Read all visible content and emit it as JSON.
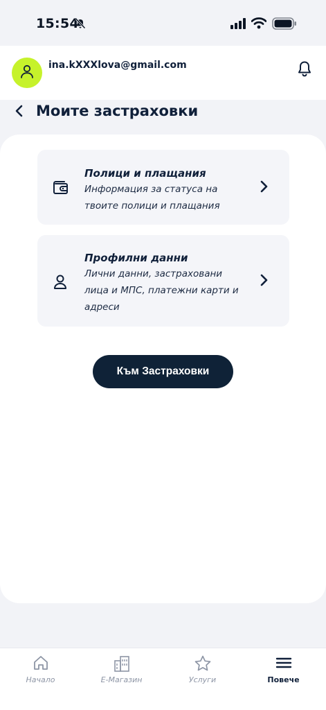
{
  "status_bar": {
    "time": "15:54"
  },
  "header": {
    "email": "ina.kXXXlova@gmail.com"
  },
  "page": {
    "title": "Моите застраховки"
  },
  "items": [
    {
      "title": "Полици и плащания",
      "description": "Информация за статуса на твоите полици и плащания",
      "icon": "wallet-icon"
    },
    {
      "title": "Профилни данни",
      "description": "Лични данни, застраховани лица и МПС, платежни карти и адреси",
      "icon": "user-icon"
    }
  ],
  "cta": {
    "label": "Към Застраховки"
  },
  "nav": [
    {
      "label": "Начало",
      "icon": "home-icon",
      "active": false
    },
    {
      "label": "Е-Магазин",
      "icon": "store-icon",
      "active": false
    },
    {
      "label": "Услуги",
      "icon": "star-icon",
      "active": false
    },
    {
      "label": "Повече",
      "icon": "menu-icon",
      "active": true
    }
  ],
  "colors": {
    "accent": "#c6f22b",
    "primary": "#0f2237",
    "background": "#f2f3f7"
  }
}
